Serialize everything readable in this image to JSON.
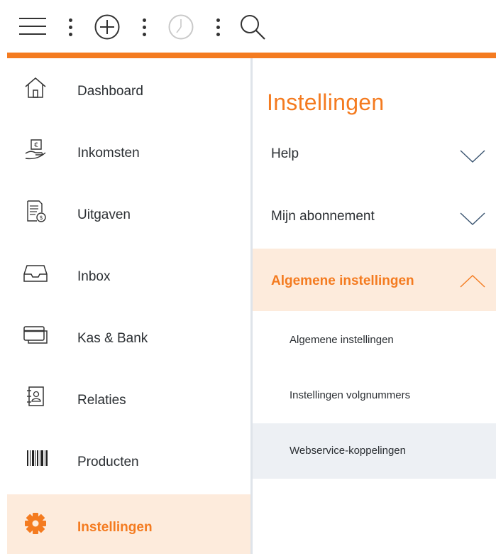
{
  "toolbar": {
    "icons": [
      "menu-icon",
      "more-vertical-icon",
      "add-icon",
      "more-vertical-icon",
      "clock-icon",
      "more-vertical-icon",
      "search-icon"
    ]
  },
  "colors": {
    "accent": "#f47b20",
    "active_bg": "#fdebdc",
    "selected_bg": "#edf0f4",
    "text": "#2b2f33"
  },
  "sidebar": {
    "items": [
      {
        "label": "Dashboard",
        "icon": "home-icon"
      },
      {
        "label": "Inkomsten",
        "icon": "income-hand-icon"
      },
      {
        "label": "Uitgaven",
        "icon": "receipt-icon"
      },
      {
        "label": "Inbox",
        "icon": "inbox-tray-icon"
      },
      {
        "label": "Kas & Bank",
        "icon": "credit-card-icon"
      },
      {
        "label": "Relaties",
        "icon": "contacts-icon"
      },
      {
        "label": "Producten",
        "icon": "barcode-icon"
      },
      {
        "label": "Instellingen",
        "icon": "gear-icon",
        "active": true
      }
    ]
  },
  "panel": {
    "title": "Instellingen",
    "sections": [
      {
        "label": "Help",
        "expanded": false
      },
      {
        "label": "Mijn abonnement",
        "expanded": false
      },
      {
        "label": "Algemene instellingen",
        "expanded": true
      }
    ],
    "subitems": [
      {
        "label": "Algemene instellingen"
      },
      {
        "label": "Instellingen volgnummers"
      },
      {
        "label": "Webservice-koppelingen",
        "selected": true
      }
    ]
  }
}
